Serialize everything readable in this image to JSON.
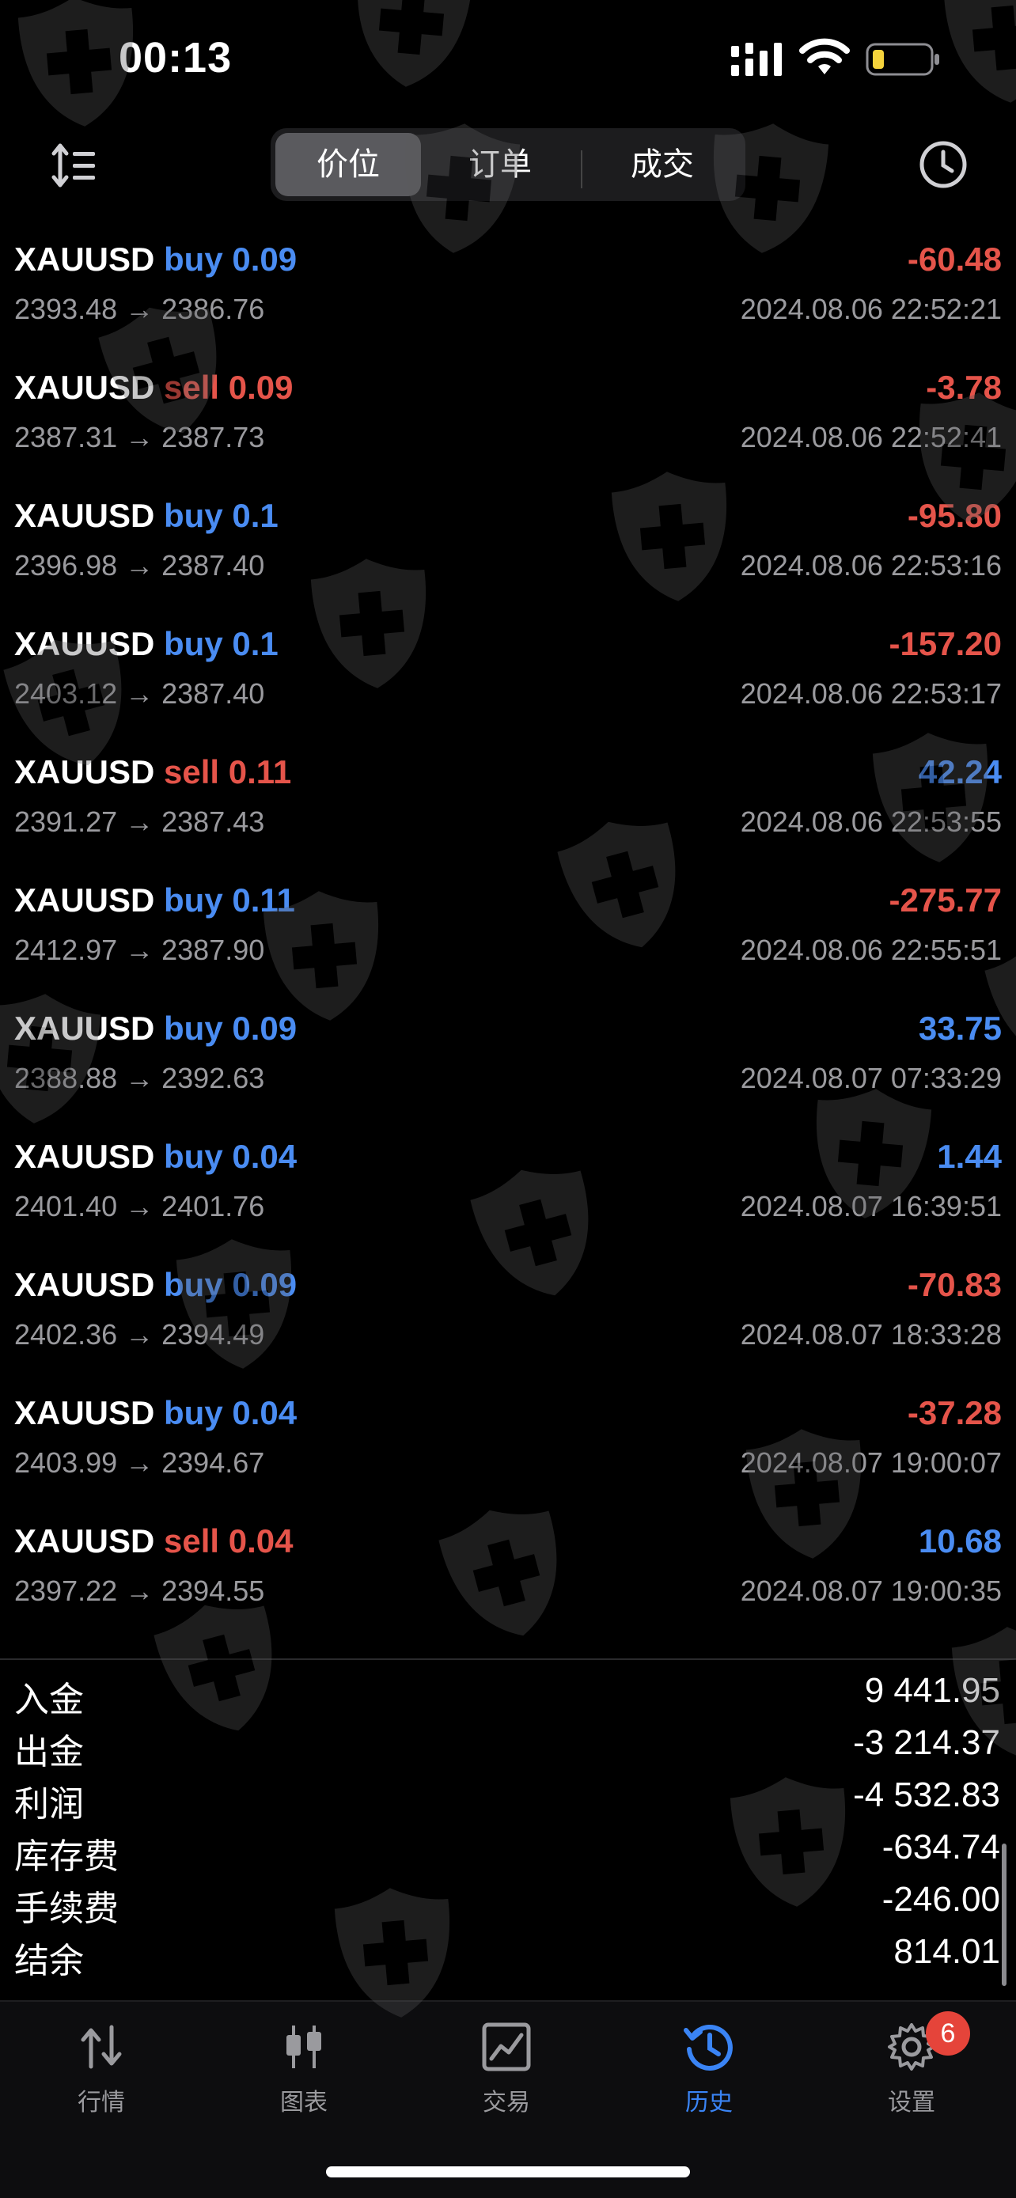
{
  "status_bar": {
    "time": "00:13"
  },
  "toolbar": {
    "segments": [
      {
        "label": "价位",
        "active": true
      },
      {
        "label": "订单",
        "active": false
      },
      {
        "label": "成交",
        "active": false
      }
    ]
  },
  "deals": [
    {
      "symbol": "XAUUSD",
      "type": "buy",
      "volume": "0.09",
      "prices": "2393.48 → 2386.76",
      "profit": "-60.48",
      "time": "2024.08.06 22:52:21"
    },
    {
      "symbol": "XAUUSD",
      "type": "sell",
      "volume": "0.09",
      "prices": "2387.31 → 2387.73",
      "profit": "-3.78",
      "time": "2024.08.06 22:52:41"
    },
    {
      "symbol": "XAUUSD",
      "type": "buy",
      "volume": "0.1",
      "prices": "2396.98 → 2387.40",
      "profit": "-95.80",
      "time": "2024.08.06 22:53:16"
    },
    {
      "symbol": "XAUUSD",
      "type": "buy",
      "volume": "0.1",
      "prices": "2403.12 → 2387.40",
      "profit": "-157.20",
      "time": "2024.08.06 22:53:17"
    },
    {
      "symbol": "XAUUSD",
      "type": "sell",
      "volume": "0.11",
      "prices": "2391.27 → 2387.43",
      "profit": "42.24",
      "time": "2024.08.06 22:53:55"
    },
    {
      "symbol": "XAUUSD",
      "type": "buy",
      "volume": "0.11",
      "prices": "2412.97 → 2387.90",
      "profit": "-275.77",
      "time": "2024.08.06 22:55:51"
    },
    {
      "symbol": "XAUUSD",
      "type": "buy",
      "volume": "0.09",
      "prices": "2388.88 → 2392.63",
      "profit": "33.75",
      "time": "2024.08.07 07:33:29"
    },
    {
      "symbol": "XAUUSD",
      "type": "buy",
      "volume": "0.04",
      "prices": "2401.40 → 2401.76",
      "profit": "1.44",
      "time": "2024.08.07 16:39:51"
    },
    {
      "symbol": "XAUUSD",
      "type": "buy",
      "volume": "0.09",
      "prices": "2402.36 → 2394.49",
      "profit": "-70.83",
      "time": "2024.08.07 18:33:28"
    },
    {
      "symbol": "XAUUSD",
      "type": "buy",
      "volume": "0.04",
      "prices": "2403.99 → 2394.67",
      "profit": "-37.28",
      "time": "2024.08.07 19:00:07"
    },
    {
      "symbol": "XAUUSD",
      "type": "sell",
      "volume": "0.04",
      "prices": "2397.22 → 2394.55",
      "profit": "10.68",
      "time": "2024.08.07 19:00:35"
    }
  ],
  "summary": [
    {
      "label": "入金",
      "value": "9 441.95"
    },
    {
      "label": "出金",
      "value": "-3 214.37"
    },
    {
      "label": "利润",
      "value": "-4 532.83"
    },
    {
      "label": "库存费",
      "value": "-634.74"
    },
    {
      "label": "手续费",
      "value": "-246.00"
    },
    {
      "label": "结余",
      "value": "814.01"
    }
  ],
  "tabs": [
    {
      "label": "行情",
      "icon": "quotes-arrows-icon",
      "active": false
    },
    {
      "label": "图表",
      "icon": "chart-candles-icon",
      "active": false
    },
    {
      "label": "交易",
      "icon": "trade-chart-icon",
      "active": false
    },
    {
      "label": "历史",
      "icon": "history-clock-icon",
      "active": true
    },
    {
      "label": "设置",
      "icon": "gear-icon",
      "active": false,
      "badge": "6"
    }
  ],
  "colors": {
    "buy": "#4a8cf2",
    "sell": "#e5544a",
    "profit_positive": "#4a8cf2",
    "profit_negative": "#e5544a",
    "active_tab": "#3a84f5",
    "watermark_shield": "#5a5a5c"
  }
}
